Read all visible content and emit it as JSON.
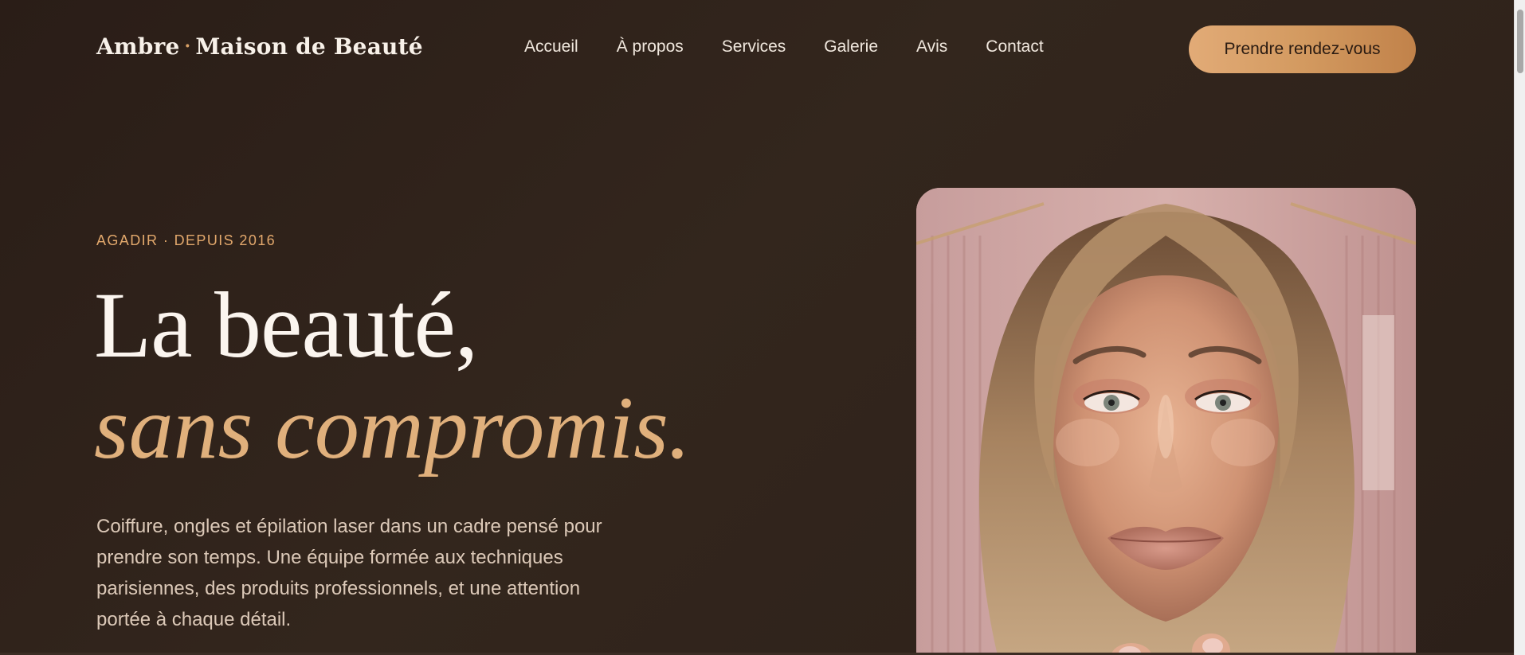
{
  "header": {
    "logo_part1": "Ambre",
    "logo_separator": "·",
    "logo_part2": "Maison de Beauté",
    "nav": [
      {
        "label": "Accueil"
      },
      {
        "label": "À propos"
      },
      {
        "label": "Services"
      },
      {
        "label": "Galerie"
      },
      {
        "label": "Avis"
      },
      {
        "label": "Contact"
      }
    ],
    "cta_label": "Prendre rendez-vous"
  },
  "hero": {
    "eyebrow": "AGADIR · DEPUIS 2016",
    "headline_line1": "La beauté,",
    "headline_line2": "sans compromis.",
    "lede": "Coiffure, ongles et épilation laser dans un cadre pensé pour prendre son temps. Une équipe formée aux techniques parisiennes, des produits professionnels, et une attention portée à chaque détail."
  },
  "colors": {
    "background": "#2e221b",
    "accent": "#e0b07c",
    "cta_gradient_start": "#e2ab77",
    "cta_gradient_end": "#c1824a",
    "text_primary": "#fbf5ef",
    "text_secondary": "#dcc9b8"
  }
}
